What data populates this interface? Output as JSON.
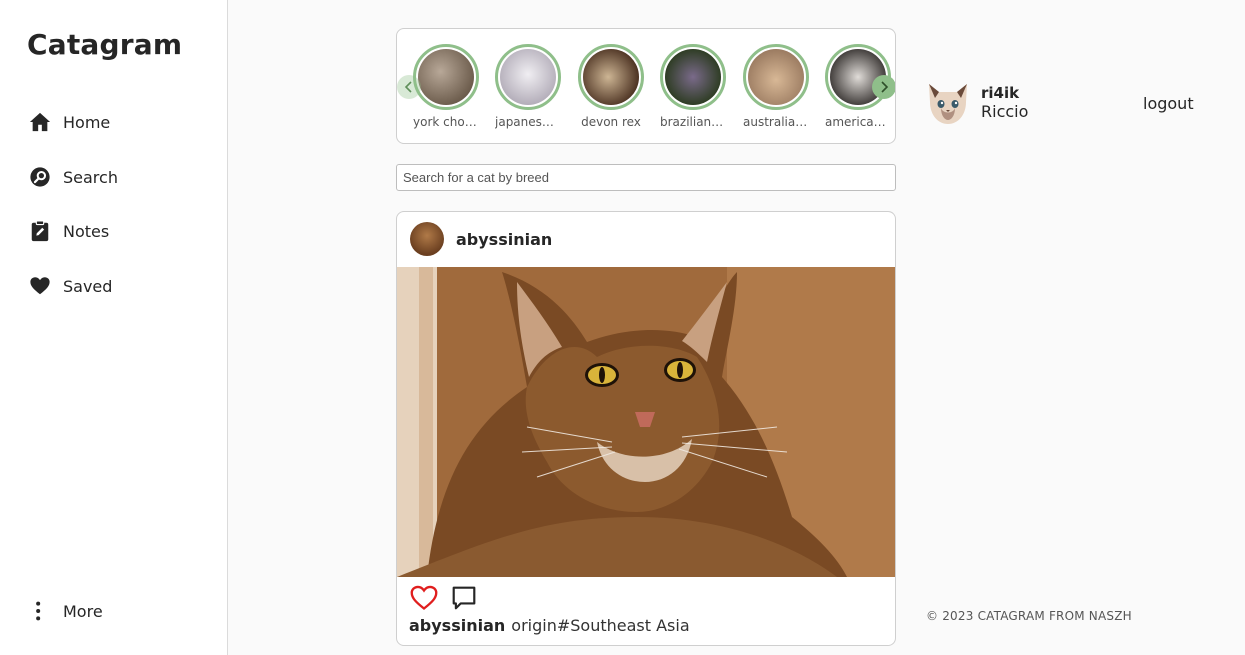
{
  "app": {
    "title": "Catagram"
  },
  "sidebar": {
    "items": [
      {
        "label": "Home",
        "icon": "home-icon"
      },
      {
        "label": "Search",
        "icon": "search-icon"
      },
      {
        "label": "Notes",
        "icon": "notes-icon"
      },
      {
        "label": "Saved",
        "icon": "heart-icon"
      }
    ],
    "more": {
      "label": "More",
      "icon": "more-vertical-icon"
    }
  },
  "stories": [
    {
      "name": "york chocolate",
      "color": "#8a7a6a"
    },
    {
      "name": "japanese bobtail",
      "color": "#c9c4cf"
    },
    {
      "name": "devon rex",
      "color": "#8a6a48"
    },
    {
      "name": "brazilian shorthair",
      "color": "#3d4a2e"
    },
    {
      "name": "australian mist",
      "color": "#b69478"
    },
    {
      "name": "american curl",
      "color": "#6f6a66"
    }
  ],
  "search": {
    "placeholder": "Search for a cat by breed",
    "value": ""
  },
  "post": {
    "username": "abyssinian",
    "caption_user": "abyssinian",
    "caption_text": "origin#Southeast Asia",
    "liked": true
  },
  "profile": {
    "username": "ri4ik",
    "name": "Riccio"
  },
  "logout": {
    "label": "logout"
  },
  "footer": {
    "text": "© 2023 CATAGRAM FROM NASZH"
  },
  "colors": {
    "accent": "#8fbf8a",
    "like": "#e01e1e"
  }
}
